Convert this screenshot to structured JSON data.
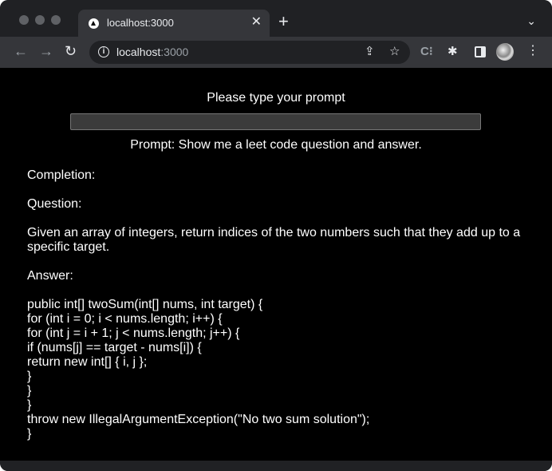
{
  "browser": {
    "tab_title": "localhost:3000",
    "tab_close": "✕",
    "new_tab": "+",
    "tab_menu": "⌄",
    "url_host": "localhost",
    "url_port": ":3000",
    "icons": [
      "back-icon",
      "forward-icon",
      "reload-icon",
      "info-icon",
      "share-icon",
      "bookmark-star-icon",
      "extension-c-icon",
      "puzzle-extensions-icon",
      "side-panel-icon",
      "profile-avatar",
      "menu-kebab-icon"
    ]
  },
  "page": {
    "heading": "Please type your prompt",
    "input_value": "",
    "prompt_echo": "Prompt: Show me a leet code question and answer.",
    "completion_label": "Completion:",
    "question_label": "Question:",
    "question_text": "Given an array of integers, return indices of the two numbers such that they add up to a specific target.",
    "answer_label": "Answer:",
    "code_lines": [
      "public int[] twoSum(int[] nums, int target) {",
      "for (int i = 0; i < nums.length; i++) {",
      "for (int j = i + 1; j < nums.length; j++) {",
      "if (nums[j] == target - nums[i]) {",
      "return new int[] { i, j };",
      "}",
      "}",
      "}",
      "throw new IllegalArgumentException(\"No two sum solution\");",
      "}"
    ]
  }
}
